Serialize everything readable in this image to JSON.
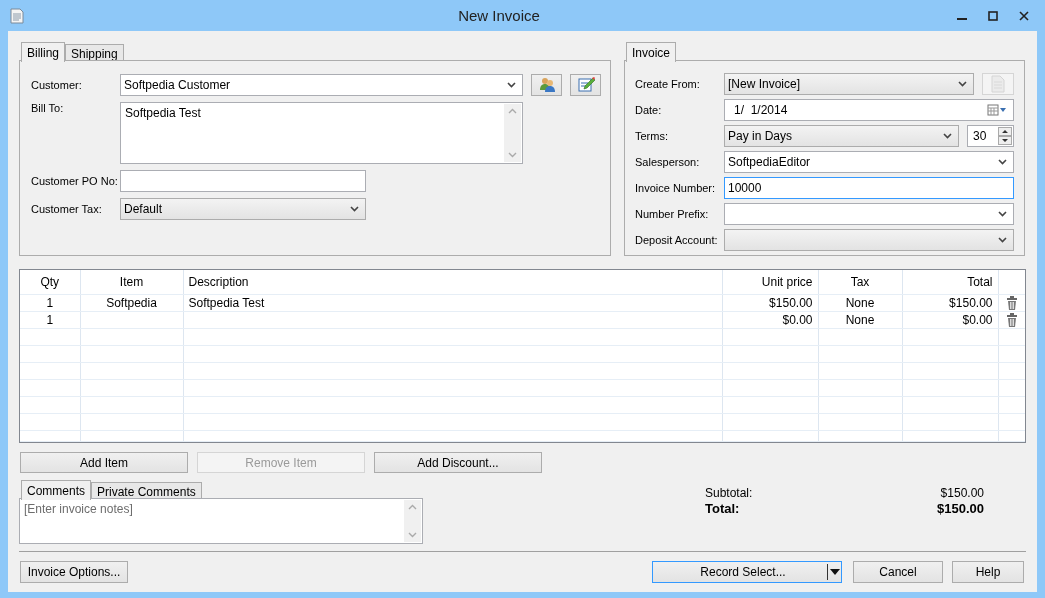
{
  "window": {
    "title": "New Invoice"
  },
  "billing": {
    "tabs": [
      {
        "label": "Billing",
        "selected": true
      },
      {
        "label": "Shipping",
        "selected": false
      }
    ],
    "fields": [
      {
        "kind": "combo",
        "label": "Customer:",
        "value": "Softpedia Customer",
        "buttons": [
          {
            "disabled": false
          },
          {
            "disabled": false
          }
        ]
      },
      {
        "kind": "memo",
        "label": "Bill To:",
        "value": "Softpedia Test"
      },
      {
        "kind": "text",
        "label": "Customer PO No:",
        "focused": false
      },
      {
        "kind": "dropdown",
        "label": "Customer Tax:",
        "value": "Default"
      }
    ]
  },
  "invoice": {
    "tabs": [
      {
        "label": "Invoice",
        "selected": true
      }
    ],
    "fields": [
      {
        "kind": "dropdown",
        "label": "Create From:",
        "value": "[New Invoice]",
        "buttons": [
          {
            "disabled": true
          }
        ]
      },
      {
        "kind": "date",
        "label": "Date:",
        "value": "1/  1/2014"
      },
      {
        "kind": "dropdown",
        "label": "Terms:",
        "value": "Pay in Days",
        "spin_value": "30"
      },
      {
        "kind": "combo",
        "label": "Salesperson:",
        "value": "SoftpediaEditor"
      },
      {
        "kind": "text",
        "label": "Invoice Number:",
        "value": "10000",
        "focused": true
      },
      {
        "kind": "combo",
        "label": "Number Prefix:"
      },
      {
        "kind": "dropdown",
        "label": "Deposit Account:"
      }
    ]
  },
  "table": {
    "columns": [
      "Qty",
      "Item",
      "Description",
      "Unit price",
      "Tax",
      "Total"
    ],
    "rows": [
      {
        "qty": "1",
        "item": "Softpedia",
        "description": "Softpedia Test",
        "unit_price": "$150.00",
        "tax": "None",
        "total": "$150.00"
      },
      {
        "qty": "1",
        "unit_price": "$0.00",
        "tax": "None",
        "total": "$0.00"
      }
    ]
  },
  "actions": [
    {
      "label": "Add Item",
      "disabled": false
    },
    {
      "label": "Remove Item",
      "disabled": true
    },
    {
      "label": "Add Discount...",
      "disabled": false
    }
  ],
  "comments": {
    "tabs": [
      {
        "label": "Comments",
        "selected": true
      },
      {
        "label": "Private Comments",
        "selected": false
      }
    ],
    "placeholder": "[Enter invoice notes]"
  },
  "totals": [
    {
      "kind": "subtotal",
      "label": "Subtotal:",
      "value": "$150.00"
    },
    {
      "kind": "total",
      "label": "Total:",
      "value": "$150.00"
    }
  ],
  "footer_buttons": [
    {
      "kind": "plain",
      "label": "Invoice Options...",
      "default": false
    },
    {
      "kind": "split",
      "label": "Record Select...",
      "default": true
    },
    {
      "kind": "plain",
      "label": "Cancel",
      "default": false
    },
    {
      "kind": "plain",
      "label": "Help",
      "default": false
    }
  ]
}
